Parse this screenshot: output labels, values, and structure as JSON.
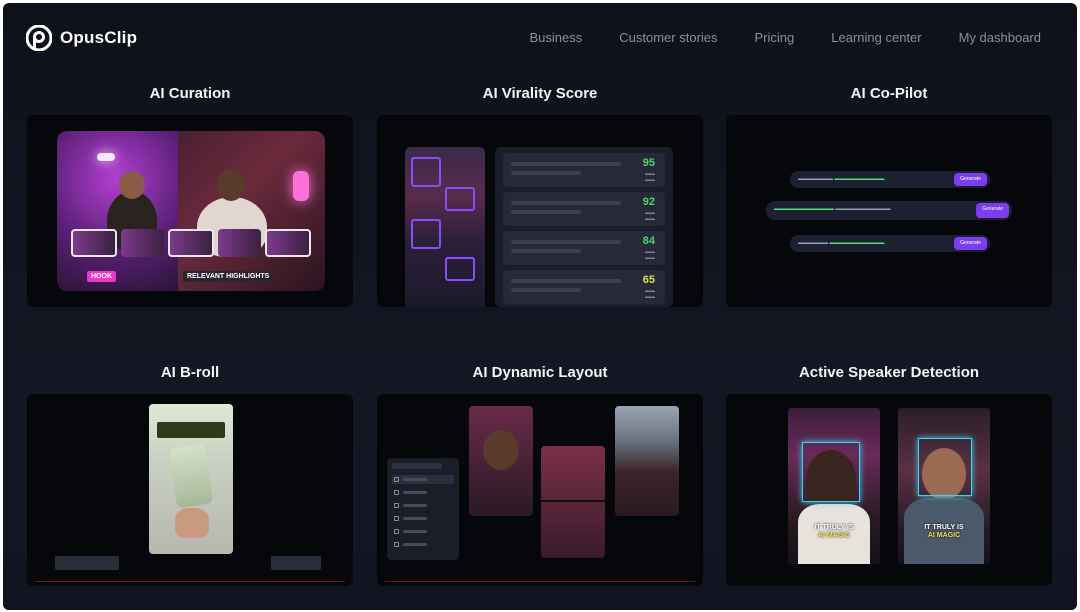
{
  "brand": {
    "name": "OpusClip"
  },
  "nav": {
    "links": [
      "Business",
      "Customer stories",
      "Pricing",
      "Learning center",
      "My dashboard"
    ]
  },
  "features": [
    {
      "title": "AI Curation",
      "tags": [
        "HOOK",
        "RELEVANT HIGHLIGHTS"
      ]
    },
    {
      "title": "AI Virality Score",
      "scores": [
        "95",
        "92",
        "84",
        "65"
      ]
    },
    {
      "title": "AI Co-Pilot",
      "generate_label": "Generate"
    },
    {
      "title": "AI B-roll"
    },
    {
      "title": "AI Dynamic Layout"
    },
    {
      "title": "Active Speaker Detection",
      "captions": [
        [
          "IT TRULY IS",
          "AI MAGIC"
        ],
        [
          "IT TRULY IS",
          "AI MAGIC"
        ]
      ]
    }
  ],
  "colors": {
    "background": "#121521",
    "accent_purple": "#7c3cf0",
    "score_green": "#48d86b",
    "tag_pink": "#e83cc8",
    "detect_cyan": "#35d7ef"
  }
}
